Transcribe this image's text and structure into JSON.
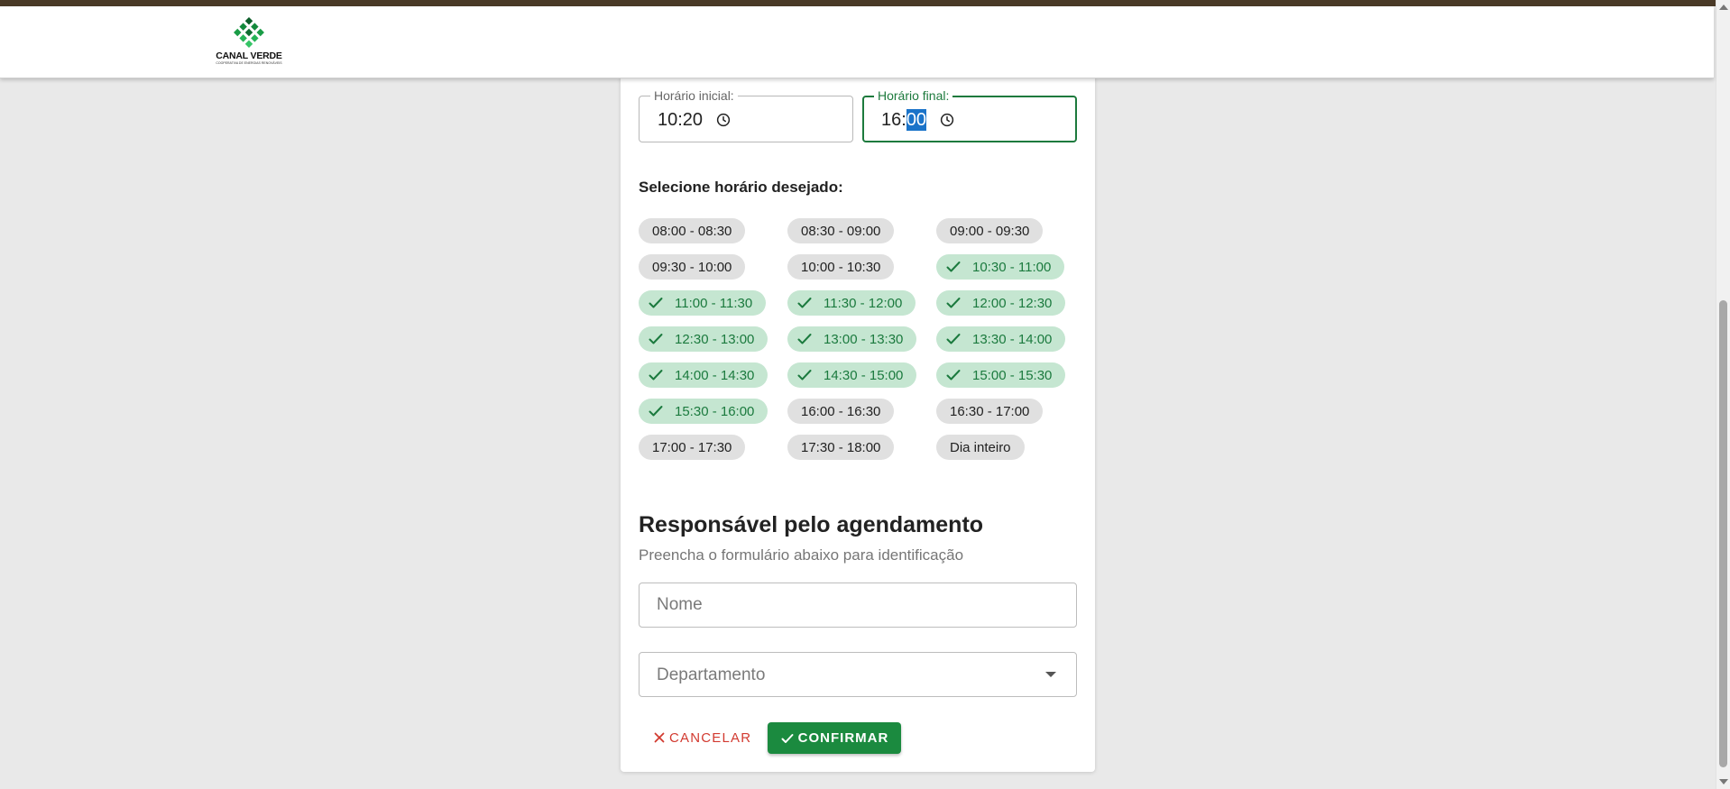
{
  "header": {
    "logo_text": "CANAL VERDE",
    "logo_subtitle": "COOPERATIVA DE ENERGIAS RENOVÁVEIS"
  },
  "time": {
    "start_label": "Horário inicial:",
    "start_value": "10:20",
    "end_label": "Horário final:",
    "end_hour": "16",
    "end_separator": ":",
    "end_minutes": "00"
  },
  "slots": {
    "label": "Selecione horário desejado:",
    "items": [
      {
        "label": "08:00 - 08:30",
        "selected": false
      },
      {
        "label": "08:30 - 09:00",
        "selected": false
      },
      {
        "label": "09:00 - 09:30",
        "selected": false
      },
      {
        "label": "09:30 - 10:00",
        "selected": false
      },
      {
        "label": "10:00 - 10:30",
        "selected": false
      },
      {
        "label": "10:30 - 11:00",
        "selected": true
      },
      {
        "label": "11:00 - 11:30",
        "selected": true
      },
      {
        "label": "11:30 - 12:00",
        "selected": true
      },
      {
        "label": "12:00 - 12:30",
        "selected": true
      },
      {
        "label": "12:30 - 13:00",
        "selected": true
      },
      {
        "label": "13:00 - 13:30",
        "selected": true
      },
      {
        "label": "13:30 - 14:00",
        "selected": true
      },
      {
        "label": "14:00 - 14:30",
        "selected": true
      },
      {
        "label": "14:30 - 15:00",
        "selected": true
      },
      {
        "label": "15:00 - 15:30",
        "selected": true
      },
      {
        "label": "15:30 - 16:00",
        "selected": true
      },
      {
        "label": "16:00 - 16:30",
        "selected": false
      },
      {
        "label": "16:30 - 17:00",
        "selected": false
      },
      {
        "label": "17:00 - 17:30",
        "selected": false
      },
      {
        "label": "17:30 - 18:00",
        "selected": false
      },
      {
        "label": "Dia inteiro",
        "selected": false
      }
    ]
  },
  "responsible": {
    "title": "Responsável pelo agendamento",
    "subtitle": "Preencha o formulário abaixo para identificação",
    "name_placeholder": "Nome",
    "department_placeholder": "Departamento"
  },
  "actions": {
    "cancel_label": "CANCELAR",
    "confirm_label": "CONFIRMAR"
  },
  "colors": {
    "brand_green": "#1b8a3f",
    "selected_chip_bg": "#c5e6d1",
    "selected_chip_text": "#1b7a3e",
    "cancel_red": "#d23a30"
  },
  "icons": [
    "logo-icon",
    "clock-icon",
    "check-icon",
    "close-icon",
    "chevron-down-icon"
  ]
}
